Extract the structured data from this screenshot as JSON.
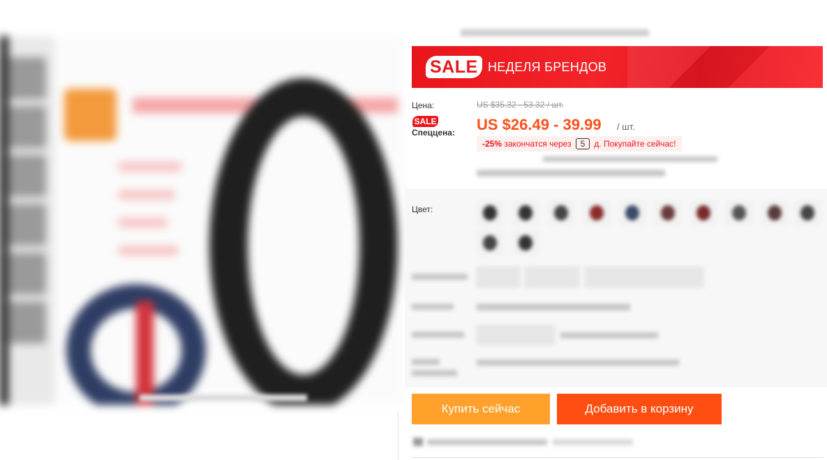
{
  "banner": {
    "badge": "SALE",
    "title": "НЕДЕЛЯ БРЕНДОВ"
  },
  "price": {
    "label": "Цена:",
    "original": "US $35.32 - 53.32 / шт.",
    "sale_badge": "SALE",
    "special_label": "Спеццена:",
    "current": "US $26.49 - 39.99",
    "unit": "/ шт.",
    "discount": "-25%",
    "ends_text": "закончатся через",
    "days": "5",
    "days_suffix": "д. Покупайте сейчас!"
  },
  "options": {
    "color_label": "Цвет:"
  },
  "actions": {
    "buy_now": "Купить сейчас",
    "add_to_cart": "Добавить в корзину"
  },
  "colors": {
    "banner_red": "#e8161b",
    "price_orange": "#ff4f1a",
    "buy_button": "#ffa12b",
    "cart_button": "#ff4e12"
  }
}
